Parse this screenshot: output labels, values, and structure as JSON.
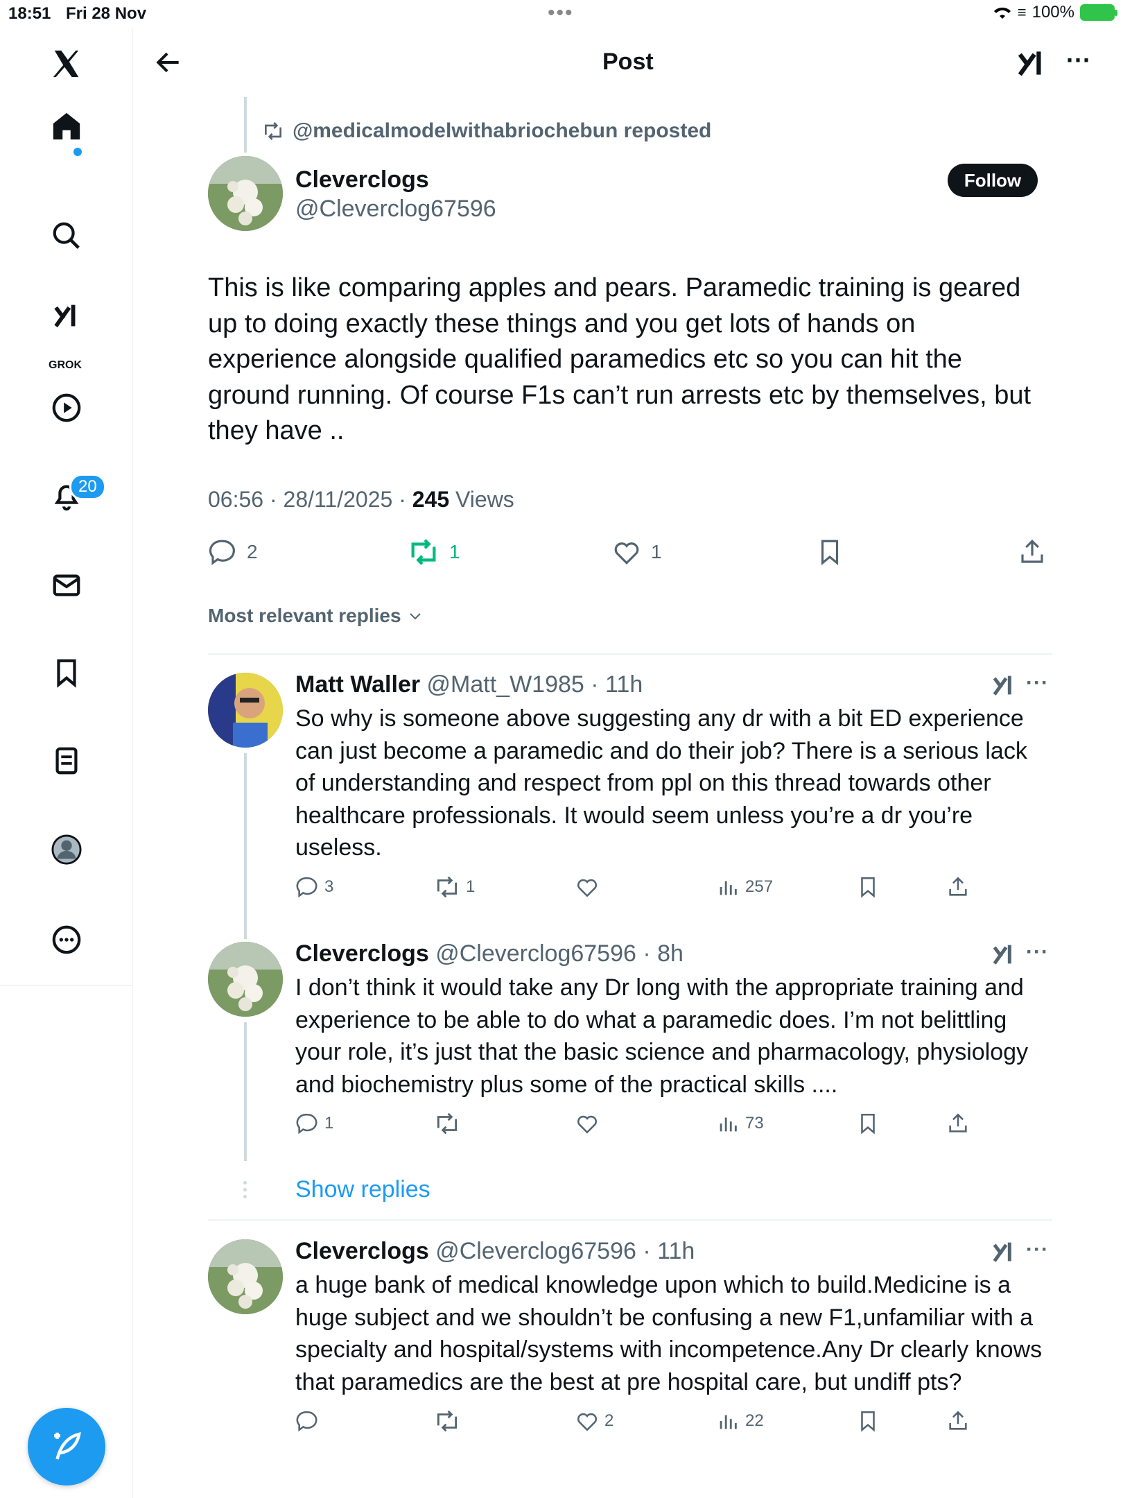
{
  "status_bar": {
    "time": "18:51",
    "date": "Fri 28 Nov",
    "battery": "100%"
  },
  "sidebar": {
    "notifications_count": "20",
    "grok_label": "GROK"
  },
  "header": {
    "title": "Post"
  },
  "post": {
    "repost_text": "@medicalmodelwithabriochebun reposted",
    "author_name": "Cleverclogs",
    "author_handle": "@Cleverclog67596",
    "follow_label": "Follow",
    "body": "This is like comparing apples and pears. Paramedic training is geared up to doing exactly these things and you get lots of hands on experience alongside qualified paramedics etc so you can hit the ground running. Of course F1s can’t run arrests etc by themselves, but they have ..",
    "timestamp": "06:56 · 28/11/2025 · ",
    "views_count": "245",
    "views_label": " Views",
    "replies": "2",
    "reposts": "1",
    "likes": "1"
  },
  "sort_label": "Most relevant replies",
  "replies": [
    {
      "name": "Matt Waller",
      "handle_time": " @Matt_W1985 · 11h",
      "body": "So why is someone above suggesting any dr with a bit ED experience can just become a paramedic and do their job? There is a serious lack of understanding and respect from ppl on this thread towards other healthcare professionals. It would seem unless you’re a dr you’re useless.",
      "replies": "3",
      "reposts": "1",
      "likes": "",
      "views": "257"
    },
    {
      "name": "Cleverclogs",
      "handle_time": " @Cleverclog67596 · 8h",
      "body": "I don’t think it would take any Dr long with the appropriate training and experience to be able to do what a paramedic does. I’m not belittling your role, it’s just that the basic science and pharmacology, physiology and biochemistry plus some of the practical skills ....",
      "replies": "1",
      "reposts": "",
      "likes": "",
      "views": "73"
    },
    {
      "name": "Cleverclogs",
      "handle_time": " @Cleverclog67596 · 11h",
      "body": "a huge bank of medical knowledge upon which to build.Medicine is a huge subject and we shouldn’t be confusing a new F1,unfamiliar with a specialty and hospital/systems with incompetence.Any Dr clearly knows that paramedics are the best at pre hospital care, but undiff pts?",
      "replies": "",
      "reposts": "",
      "likes": "2",
      "views": "22"
    }
  ],
  "show_replies_label": "Show replies",
  "colors": {
    "accent": "#1d9bf0",
    "repost_green": "#00ba7c",
    "text": "#0f1419",
    "muted": "#536471"
  }
}
